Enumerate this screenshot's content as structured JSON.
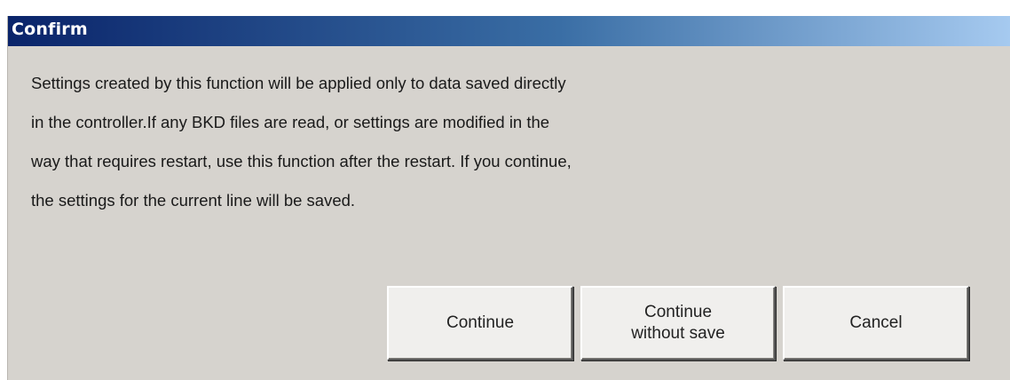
{
  "dialog": {
    "title": "Confirm",
    "message_lines": [
      "Settings created by this function will be applied only to data saved directly",
      "in the controller.If any BKD files are read, or settings are modified in the",
      "way that requires restart, use this function after the restart. If you continue,",
      "the settings for the current line will be saved."
    ],
    "buttons": {
      "continue": "Continue",
      "continue_without_save_line1": "Continue",
      "continue_without_save_line2": "without save",
      "cancel": "Cancel"
    }
  },
  "colors": {
    "titlebar_start": "#0a246a",
    "titlebar_end": "#a6caf0",
    "dialog_bg": "#d6d3ce",
    "button_bg": "#f0efed"
  }
}
